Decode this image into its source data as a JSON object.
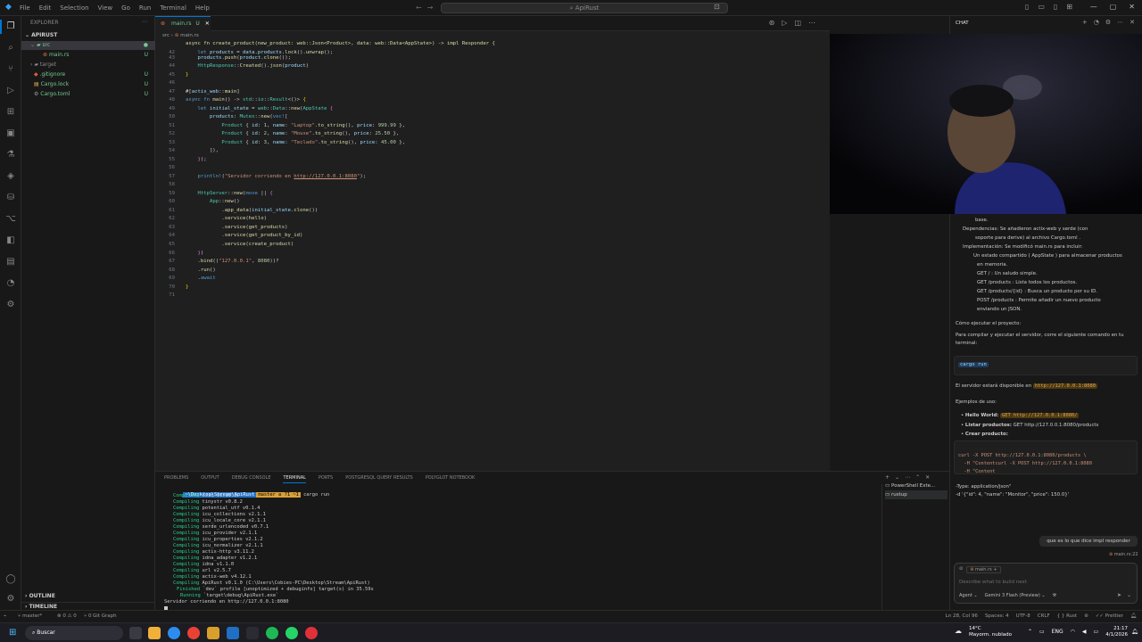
{
  "window": {
    "title": "ApiRust",
    "search_placeholder": "ApiRust"
  },
  "menu": [
    "File",
    "Edit",
    "Selection",
    "View",
    "Go",
    "Run",
    "Terminal",
    "Help"
  ],
  "explorer": {
    "title": "EXPLORER",
    "project": "APIRUST",
    "items": [
      {
        "label": "src",
        "badge": "●"
      },
      {
        "label": "main.rs",
        "badge": "U"
      },
      {
        "label": "target",
        "badge": ""
      },
      {
        "label": ".gitignore",
        "badge": "U"
      },
      {
        "label": "Cargo.lock",
        "badge": "U"
      },
      {
        "label": "Cargo.toml",
        "badge": "U"
      }
    ],
    "outline": "OUTLINE",
    "timeline": "TIMELINE"
  },
  "editor": {
    "tab": "main.rs",
    "tab_status": "U",
    "breadcrumb": [
      "src",
      "main.rs"
    ],
    "sticky": "async fn create_product(new_product: web::Json<Product>, data: web::Data<AppState>) -> impl Responder {"
  },
  "panel": {
    "tabs": [
      "PROBLEMS",
      "OUTPUT",
      "DEBUG CONSOLE",
      "TERMINAL",
      "PORTS",
      "POSTGRESQL QUERY RESULTS",
      "POLYGLOT NOTEBOOK"
    ],
    "prompt_path": "~\\Desktop\\Stream\\ApiRust",
    "prompt_branch": "master ≡ ?1 ~1",
    "command": "cargo run",
    "compiling": [
      "sstd v0.13.3",
      "tinystr v0.8.2",
      "potential_utf v0.1.4",
      "icu_collections v2.1.1",
      "icu_locale_core v2.1.1",
      "serde_urlencoded v0.7.1",
      "icu_provider v2.1.1",
      "icu_properties v2.1.2",
      "icu_normalizer v2.1.1",
      "actix-http v3.11.2",
      "idna_adapter v1.2.1",
      "idna v1.1.0",
      "url v2.5.7",
      "actix-web v4.12.1",
      "ApiRust v0.1.0 (C:\\Users\\Cobies-PC\\Desktop\\Stream\\ApiRust)"
    ],
    "compiling_label": "Compiling",
    "finished_label": "Finished",
    "finished_text": "`dev` profile [unoptimized + debuginfo] target(s) in 35.59s",
    "running_label": "Running",
    "running_text": "`target\\debug\\ApiRust.exe`",
    "server_line": "Servidor corriendo en http://127.0.0.1:8080",
    "terminals": [
      "PowerShell Exte...",
      "rustup"
    ]
  },
  "chat": {
    "title": "CHAT",
    "lines": {
      "inicializacion": "Inicialización: Se ejecutó cargo init para crear la estructura",
      "base": "base.",
      "dependencias_a": "Dependencias: Se añadieron actix-web y serde (con",
      "dependencias_b": "soporte para derive) al archivo Cargo.toml .",
      "implementacion": "Implementación: Se modificó main.rs para incluir:",
      "estado_a": "Un estado compartido ( AppState ) para almacenar productos",
      "estado_b": "en memoria.",
      "get_root": "GET / : Un saludo simple.",
      "get_products": "GET /products : Lista todos los productos.",
      "get_id": "GET /products/{id} : Busca un producto por su ID.",
      "post_a": "POST /products : Permite añadir un nuevo producto",
      "post_b": "enviando un JSON.",
      "como_ejecutar": "Cómo ejecutar el proyecto:",
      "para_compilar_a": "Para compilar y ejecutar el servidor, corre el siguiente comando en tu",
      "para_compilar_b": "terminal:",
      "cargo_run": "cargo run",
      "servidor_disp": "El servidor estará disponible en",
      "servidor_url": "http://127.0.0.1:8080",
      "ejemplos": "Ejemplos de uso:",
      "hello": "Hello World:",
      "hello_val": "GET http://127.0.0.1:8080/",
      "listar": "Listar productos:",
      "listar_val": "GET http://127.0.0.1:8080/products",
      "crear": "Crear producto:",
      "curl1": "curl -X POST http://127.0.0.1:8080/products \\",
      "curl2": "  -H \"Contentcurl -X POST http://127.0.0.1:8080",
      "curl3": "  -H \"Content",
      "type": "-Type: application/json\"",
      "data": "-d '{\"id\": 4, \"name\": \"Monitor\", \"price\": 150.0}'",
      "user_msg": "que es lo que dice impl responder",
      "attach": "main.rs:22"
    },
    "input_placeholder": "Describe what to build next",
    "input_file": "main.rs",
    "agent": "Agent",
    "model": "Gemini 3 Flash (Preview)"
  },
  "statusbar": {
    "branch": "master*",
    "errors": "⊗ 0  ⚠ 0",
    "ports": "⑂ 0",
    "graph": "Git Graph",
    "position": "Ln 28, Col 96",
    "spaces": "Spaces: 4",
    "encoding": "UTF-8",
    "eol": "CRLF",
    "language": "Rust",
    "prettier": "Prettier"
  },
  "taskbar": {
    "search": "Buscar",
    "weather_temp": "14°C",
    "weather_desc": "Mayorm. nublado",
    "lang": "ENG",
    "time": "21:17",
    "date": "4/1/2026"
  }
}
